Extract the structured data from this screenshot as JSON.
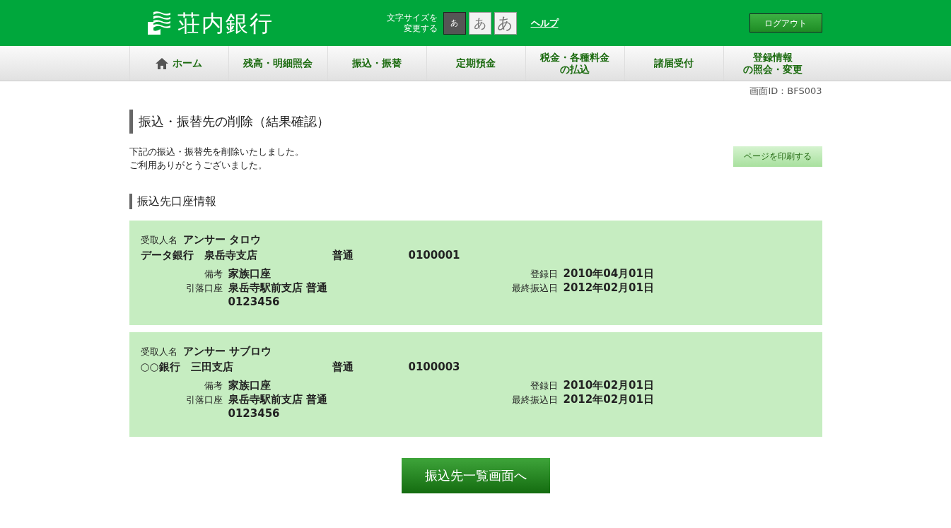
{
  "header": {
    "logo_text": "荘内銀行",
    "font_size_label": [
      "文字サイズを",
      "変更する"
    ],
    "font_sizes": [
      {
        "label": "あ",
        "selected": true
      },
      {
        "label": "あ",
        "selected": false
      },
      {
        "label": "あ",
        "selected": false
      }
    ],
    "help_link": "ヘルプ",
    "logout_button": "ログアウト"
  },
  "nav": [
    {
      "label": [
        "ホーム"
      ],
      "kind": "home"
    },
    {
      "label": [
        "残高・明細照会"
      ],
      "kind": "text"
    },
    {
      "label": [
        "振込・振替"
      ],
      "kind": "text"
    },
    {
      "label": [
        "定期預金"
      ],
      "kind": "text"
    },
    {
      "label": [
        "税金・各種料金",
        "の払込"
      ],
      "kind": "text"
    },
    {
      "label": [
        "諸届受付"
      ],
      "kind": "text"
    },
    {
      "label": [
        "登録情報",
        "の照会・変更"
      ],
      "kind": "text"
    }
  ],
  "screen_id": "画面ID：BFS003",
  "title": "振込・振替先の削除（結果確認）",
  "message": [
    "下記の振込・振替先を削除いたしました。",
    "ご利用ありがとうございました。"
  ],
  "print_button": "ページを印刷する",
  "section_title": "振込先口座情報",
  "recipients": [
    {
      "payee_label": "受取人名",
      "payee": "アンサー タロウ",
      "bank": "データ銀行　泉岳寺支店",
      "account_type": "普通",
      "account_number": "0100001",
      "fields_left": [
        {
          "label": "備考",
          "value": "家族口座"
        },
        {
          "label": "引落口座",
          "value": "泉岳寺駅前支店 普通\n0123456"
        }
      ],
      "fields_right": [
        {
          "label": "登録日",
          "value": "2010年04月01日"
        },
        {
          "label": "最終振込日",
          "value": "2012年02月01日"
        }
      ]
    },
    {
      "payee_label": "受取人名",
      "payee": "アンサー サブロウ",
      "bank": "○○銀行　三田支店",
      "account_type": "普通",
      "account_number": "0100003",
      "fields_left": [
        {
          "label": "備考",
          "value": "家族口座"
        },
        {
          "label": "引落口座",
          "value": "泉岳寺駅前支店 普通\n0123456"
        }
      ],
      "fields_right": [
        {
          "label": "登録日",
          "value": "2010年02月01日"
        },
        {
          "label": "最終振込日",
          "value": "2012年02月01日"
        }
      ]
    }
  ],
  "back_button": "振込先一覧画面へ"
}
